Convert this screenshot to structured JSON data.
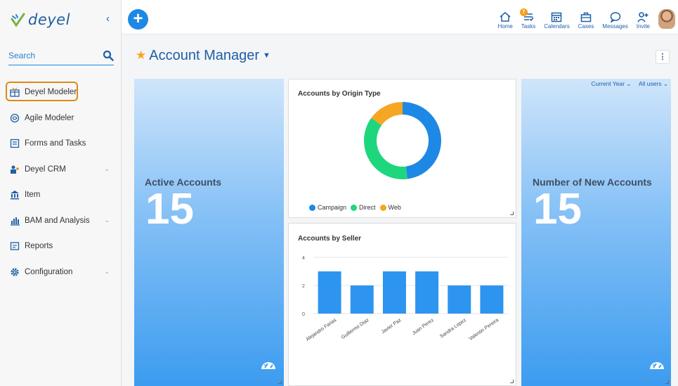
{
  "app": {
    "logo_text": "deyel",
    "collapse_glyph": "‹"
  },
  "search": {
    "placeholder": "Search",
    "icon": "search-icon"
  },
  "sidebar": {
    "items": [
      {
        "label": "Deyel Modeler",
        "icon": "deyel-modeler-icon",
        "active": true,
        "has_children": false
      },
      {
        "label": "Agile Modeler",
        "icon": "agile-modeler-icon",
        "active": false,
        "has_children": false
      },
      {
        "label": "Forms and Tasks",
        "icon": "forms-icon",
        "active": false,
        "has_children": false
      },
      {
        "label": "Deyel CRM",
        "icon": "crm-icon",
        "active": false,
        "has_children": true
      },
      {
        "label": "Item",
        "icon": "bank-icon",
        "active": false,
        "has_children": false
      },
      {
        "label": "BAM and Analysis",
        "icon": "bar-chart-icon",
        "active": false,
        "has_children": true
      },
      {
        "label": "Reports",
        "icon": "report-icon",
        "active": false,
        "has_children": false
      },
      {
        "label": "Configuration",
        "icon": "gear-icon",
        "active": false,
        "has_children": true
      }
    ]
  },
  "topbar": {
    "add_label": "+",
    "actions": [
      {
        "label": "Home",
        "icon": "home-icon"
      },
      {
        "label": "Tasks",
        "icon": "tasks-icon",
        "badge": "7"
      },
      {
        "label": "Calendars",
        "icon": "calendar-icon"
      },
      {
        "label": "Cases",
        "icon": "briefcase-icon"
      },
      {
        "label": "Messages",
        "icon": "message-icon"
      },
      {
        "label": "Invite",
        "icon": "invite-icon"
      }
    ]
  },
  "page": {
    "title": "Account Manager",
    "title_chevron": "⌄",
    "menu_glyph": "⋮"
  },
  "filters": {
    "period": "Current Year",
    "users": "All users"
  },
  "tiles": {
    "active": {
      "label": "Active Accounts",
      "value": "15"
    },
    "new": {
      "label": "Number of New Accounts",
      "value": "15"
    }
  },
  "donut": {
    "title": "Accounts by Origin Type"
  },
  "bar": {
    "title": "Accounts by Seller"
  },
  "colors": {
    "campaign": "#1e88e5",
    "direct": "#1ed67c",
    "web": "#f5a623",
    "bar": "#2d95ef",
    "accent": "#1e5fa8"
  },
  "chart_data": [
    {
      "type": "pie",
      "title": "Accounts by Origin Type",
      "categories": [
        "Campaign",
        "Direct",
        "Web"
      ],
      "values": [
        48,
        37,
        15
      ],
      "legend": "bottom-left"
    },
    {
      "type": "bar",
      "title": "Accounts by Seller",
      "categories": [
        "Alejandro Farias",
        "Guillermo Diaz",
        "Javier Paz",
        "Juan Perez",
        "Sandra Lopez",
        "Valentin Pereira"
      ],
      "values": [
        3,
        2,
        3,
        3,
        2,
        2
      ],
      "yticks": [
        0,
        2,
        4
      ],
      "ylim": [
        0,
        4
      ],
      "grid": true
    }
  ]
}
